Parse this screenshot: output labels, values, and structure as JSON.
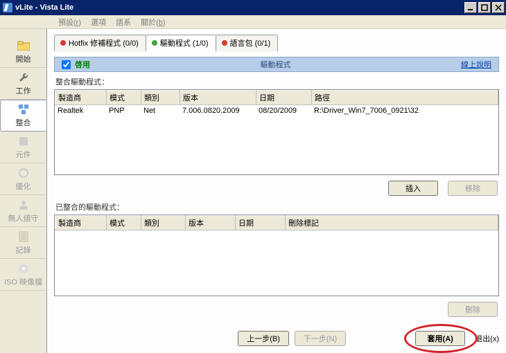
{
  "window": {
    "title": "vLite - Vista Lite"
  },
  "menu": {
    "preset": "預設",
    "preset_u": "r",
    "options": "選項",
    "language": "語系",
    "about": "關於",
    "about_u": "b"
  },
  "sidebar": [
    {
      "label": "開始",
      "enabled": true
    },
    {
      "label": "工作",
      "enabled": true
    },
    {
      "label": "整合",
      "enabled": true,
      "selected": true
    },
    {
      "label": "元件",
      "enabled": false
    },
    {
      "label": "優化",
      "enabled": false
    },
    {
      "label": "無人値守",
      "enabled": false
    },
    {
      "label": "記錄",
      "enabled": false
    },
    {
      "label": "ISO 映像檔",
      "enabled": false
    }
  ],
  "top_tabs": {
    "hotfix": "Hotfix 修補程式 (0/0)",
    "drivers": "驅動程式 (1/0)",
    "language": "語言包 (0/1)"
  },
  "bluebar": {
    "enable": "啓用",
    "title": "驅動程式",
    "help": "線上說明"
  },
  "section1_label": "整合驅動程式：",
  "table1": {
    "headers": {
      "mfr": "製造商",
      "mode": "模式",
      "class": "類別",
      "version": "版本",
      "date": "日期",
      "path": "路徑"
    },
    "rows": [
      {
        "mfr": "Realtek",
        "mode": "PNP",
        "class": "Net",
        "version": "7.006.0820.2009",
        "date": "08/20/2009",
        "path": "R:\\Driver_Win7_7006_0921\\32"
      }
    ]
  },
  "buttons1": {
    "insert": "插入",
    "remove": "移除"
  },
  "section2_label": "已整合的驅動程式：",
  "table2": {
    "headers": {
      "mfr": "製造商",
      "mode": "模式",
      "class": "類別",
      "version": "版本",
      "date": "日期",
      "delmark": "刪除標記"
    }
  },
  "buttons2": {
    "delete": "刪除"
  },
  "nav": {
    "prev": "上一步(B)",
    "next": "下一步(N)",
    "apply": "套用(A)",
    "exit": "退出(x)"
  }
}
